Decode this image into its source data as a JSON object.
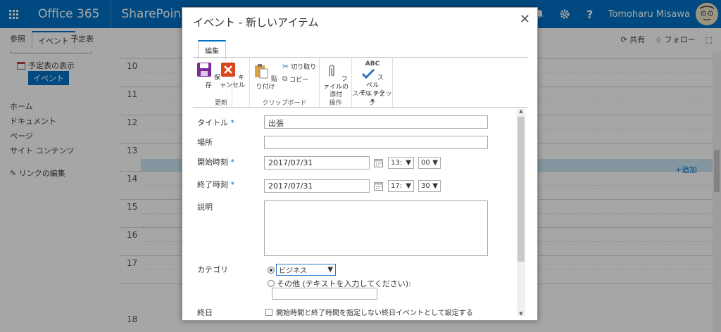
{
  "suitebar": {
    "brand": "Office 365",
    "app": "SharePoint",
    "username": "Tomoharu Misawa",
    "icons": [
      "waffle-icon",
      "bell-icon",
      "gear-icon",
      "help-icon"
    ],
    "color": "#0072c6"
  },
  "ribbon_tabs": {
    "browse": "参照",
    "event": "イベント",
    "calendar": "予定表"
  },
  "page_actions": {
    "share": "共有",
    "follow": "フォロー"
  },
  "leftnav": {
    "calendar_view": "予定表の表示",
    "event": "イベント",
    "links": [
      "ホーム",
      "ドキュメント",
      "ページ",
      "サイト コンテンツ"
    ],
    "edit_links": "リンクの編集"
  },
  "calendar": {
    "hours": [
      "10",
      "11",
      "12",
      "13",
      "14",
      "15",
      "16",
      "17",
      "18"
    ],
    "selected_hour": "13",
    "add": "追加",
    "selected_color": "#cde6f7"
  },
  "dialog": {
    "title": "イベント - 新しいアイテム",
    "ribbon_tab": "編集",
    "groups": {
      "commit": {
        "label": "更新",
        "save": "保存",
        "cancel": "キャンセル"
      },
      "clipboard": {
        "label": "クリップボード",
        "paste": "貼り付け",
        "cut": "切り取り",
        "copy": "コピー"
      },
      "actions": {
        "label": "操作",
        "attach_line1": "ファイルの",
        "attach_line2": "添付"
      },
      "spelling": {
        "label": "スペル チェック",
        "badge": "ABC",
        "btn_line1": "スペル",
        "btn_line2": "チェック"
      }
    },
    "form": {
      "title_label": "タイトル",
      "title_value": "出張",
      "location_label": "場所",
      "location_value": "",
      "start_label": "開始時刻",
      "start_date": "2017/07/31",
      "start_hour": "13:",
      "start_min": "00",
      "end_label": "終了時刻",
      "end_date": "2017/07/31",
      "end_hour": "17:",
      "end_min": "30",
      "description_label": "説明",
      "category_label": "カテゴリ",
      "category_selected": "ビジネス",
      "category_other": "その他 (テキストを入力してください):",
      "allday_label": "終日",
      "allday_text": "開始時間と終了時間を指定しない終日イベントとして設定する"
    }
  }
}
